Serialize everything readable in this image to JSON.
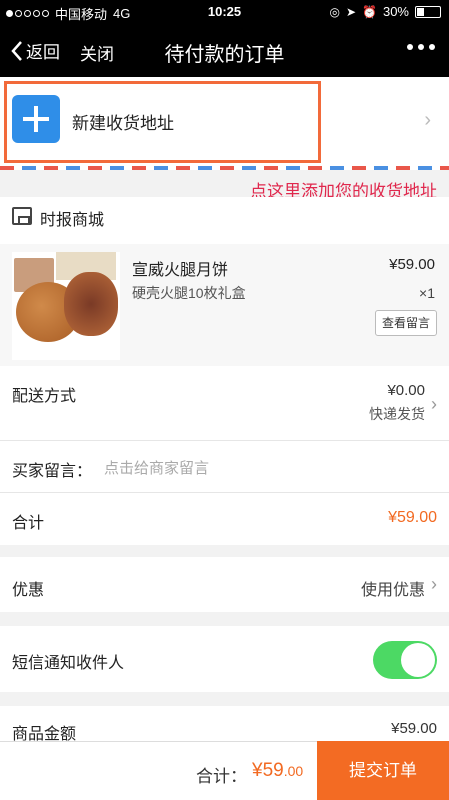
{
  "status_bar": {
    "carrier": "中国移动",
    "network": "4G",
    "time": "10:25",
    "battery": "30%",
    "battery_level": 0.3
  },
  "nav": {
    "back_label": "返回",
    "close_label": "关闭",
    "title": "待付款的订单"
  },
  "address": {
    "new_label": "新建收货地址",
    "hint": "点这里添加您的收货地址"
  },
  "shop": {
    "name": "时报商城"
  },
  "product": {
    "name": "宣威火腿月饼",
    "spec": "硬壳火腿10枚礼盒",
    "price": "¥59.00",
    "qty": "×1",
    "view_message_label": "查看留言"
  },
  "shipping": {
    "label": "配送方式",
    "price": "¥0.00",
    "method": "快递发货"
  },
  "buyer_message": {
    "label": "买家留言：",
    "placeholder": "点击给商家留言"
  },
  "subtotal": {
    "label": "合计",
    "value": "¥59.00"
  },
  "discount": {
    "label": "优惠",
    "value": "使用优惠"
  },
  "sms": {
    "label": "短信通知收件人",
    "enabled": true
  },
  "goods_amount": {
    "label": "商品金额",
    "value": "¥59.00"
  },
  "bottom": {
    "total_label": "合计：",
    "total_value": "¥59",
    "total_decimal": ".00",
    "submit_label": "提交订单"
  },
  "colors": {
    "accent": "#f36b23",
    "toggle_on": "#4cd964",
    "plus_bg": "#2f8ee8",
    "hint": "#e0284d"
  }
}
